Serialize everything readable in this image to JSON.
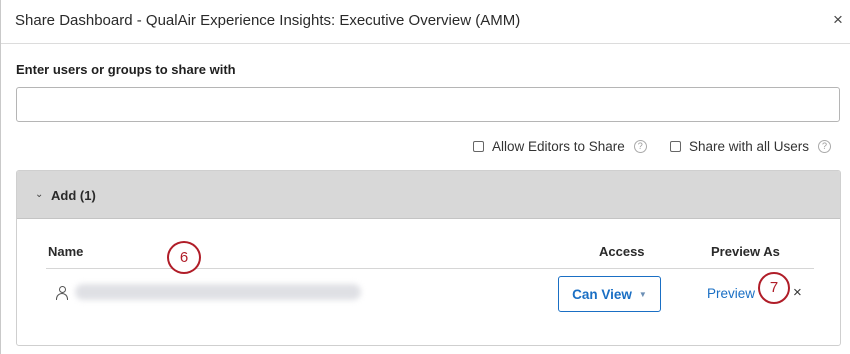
{
  "dialog": {
    "title": "Share Dashboard - QualAir Experience Insights: Executive Overview (AMM)",
    "close_glyph": "×"
  },
  "share": {
    "label": "Enter users or groups to share with",
    "input_value": "",
    "input_placeholder": ""
  },
  "options": {
    "allow_editors": {
      "label": "Allow Editors to Share",
      "checked": false
    },
    "share_all": {
      "label": "Share with all Users",
      "checked": false
    },
    "help_glyph": "?"
  },
  "add_panel": {
    "toggle_glyph": "⌄",
    "title": "Add (1)",
    "columns": {
      "name": "Name",
      "access": "Access",
      "preview_as": "Preview As"
    },
    "rows": [
      {
        "access_label": "Can View",
        "preview_label": "Preview",
        "remove_glyph": "×"
      }
    ]
  },
  "callouts": [
    "6",
    "7"
  ],
  "colors": {
    "accent": "#1a6fc4",
    "panel_header": "#d8d8d8",
    "callout": "#b01d28"
  }
}
